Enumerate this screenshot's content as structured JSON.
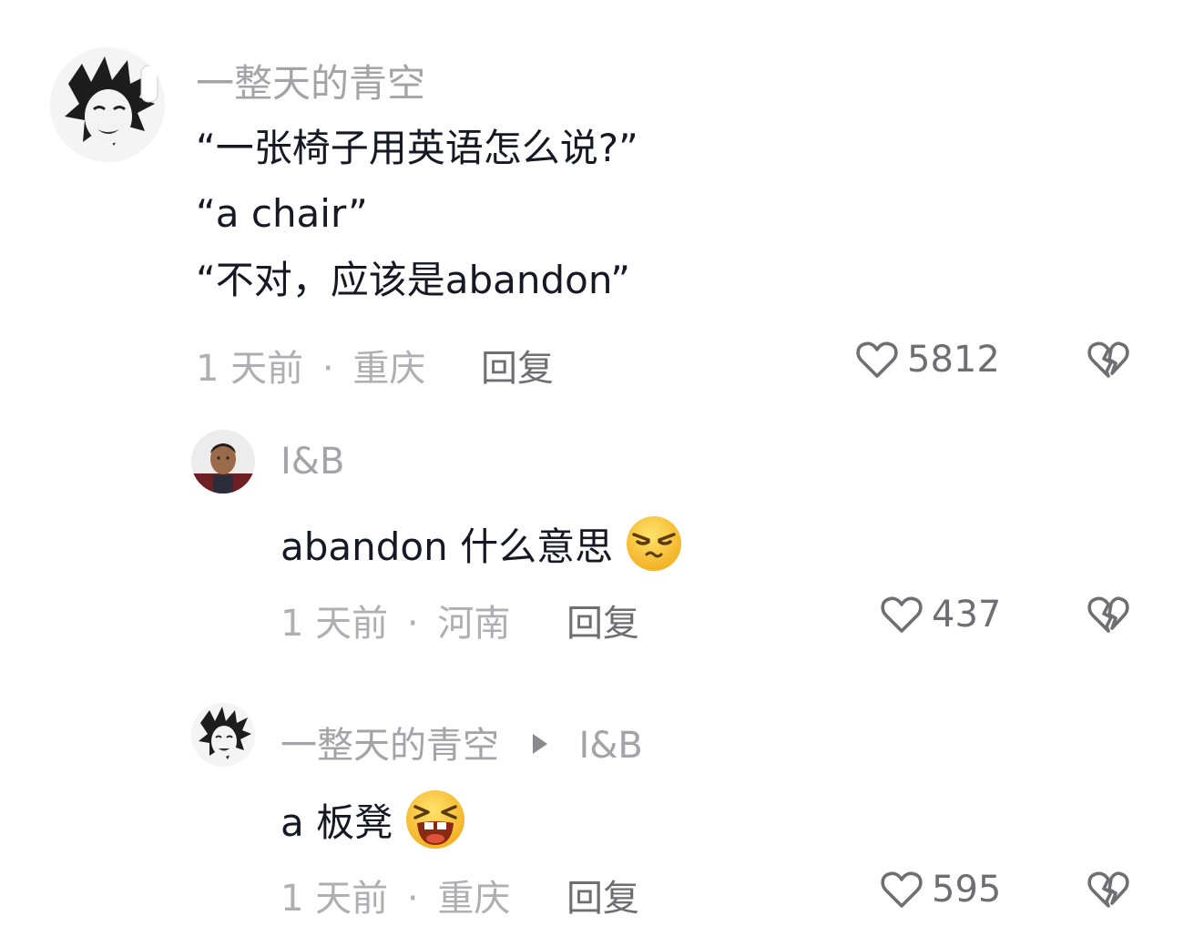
{
  "comments": [
    {
      "username": "一整天的青空",
      "lines": [
        "“一张椅子用英语怎么说?”",
        "“a chair”",
        "“不对，应该是abandon”"
      ],
      "time": "1 天前",
      "location": "重庆",
      "reply_label": "回复",
      "likes": "5812"
    },
    {
      "username": "I&B",
      "text": "abandon 什么意思",
      "emoji": "smirk-face-emoji",
      "time": "1 天前",
      "location": "河南",
      "reply_label": "回复",
      "likes": "437"
    },
    {
      "username": "一整天的青空",
      "reply_to": "I&B",
      "text": "a 板凳",
      "emoji": "laughing-face-emoji",
      "time": "1 天前",
      "location": "重庆",
      "reply_label": "回复",
      "likes": "595"
    }
  ],
  "separator": "·",
  "colors": {
    "username": "#a3a3a8",
    "body": "#161823",
    "meta": "#aeaeb3",
    "action": "#6e6e73",
    "emoji_yellow": "#f7c531"
  },
  "icons": {
    "like": "heart-outline-icon",
    "dislike": "broken-heart-icon",
    "reply_arrow": "triangle-right-icon"
  }
}
